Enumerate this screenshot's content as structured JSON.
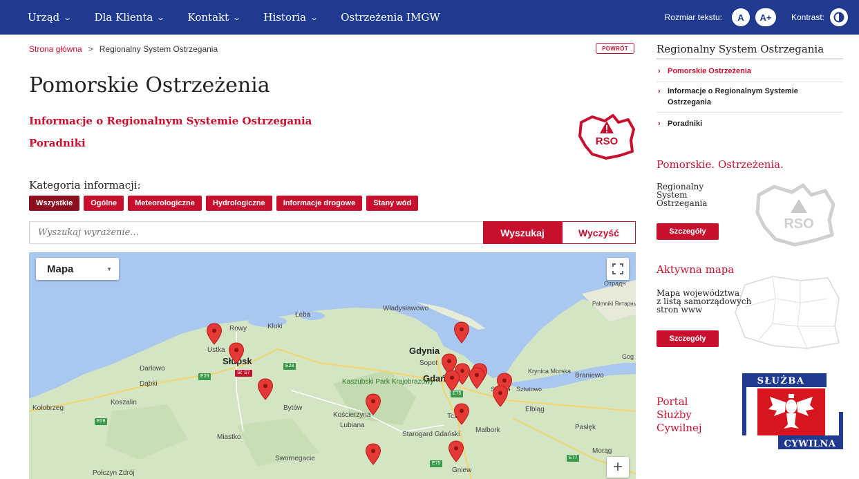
{
  "topnav": {
    "items": [
      {
        "label": "Urząd",
        "has_dropdown": true
      },
      {
        "label": "Dla Klienta",
        "has_dropdown": true
      },
      {
        "label": "Kontakt",
        "has_dropdown": true
      },
      {
        "label": "Historia",
        "has_dropdown": true
      },
      {
        "label": "Ostrzeżenia IMGW",
        "has_dropdown": false
      }
    ],
    "text_size_label": "Rozmiar tekstu:",
    "text_size_normal": "A",
    "text_size_large": "A+",
    "contrast_label": "Kontrast:",
    "bg_color": "#1f3a8f"
  },
  "breadcrumb": {
    "home": "Strona główna",
    "separator": ">",
    "current": "Regionalny System Ostrzegania"
  },
  "back_button": "POWRÓT",
  "page": {
    "title": "Pomorskie Ostrzeżenia",
    "link_info": "Informacje o Regionalnym Systemie Ostrzegania",
    "link_guides": "Poradniki",
    "logo_text": "RSO"
  },
  "filters": {
    "label": "Kategoria informacji:",
    "items": [
      "Wszystkie",
      "Ogólne",
      "Meteorologiczne",
      "Hydrologiczne",
      "Informacje drogowe",
      "Stany wód"
    ],
    "active": "Wszystkie"
  },
  "search": {
    "placeholder": "Wyszukaj wyrażenie...",
    "value": "",
    "search_label": "Wyszukaj",
    "clear_label": "Wyczyść"
  },
  "map": {
    "type_selected": "Mapa",
    "zoom_in": "+",
    "places": [
      {
        "name": "Władysławowo"
      },
      {
        "name": "Łeba"
      },
      {
        "name": "Rowy"
      },
      {
        "name": "Kluki"
      },
      {
        "name": "Ustka"
      },
      {
        "name": "Słupsk"
      },
      {
        "name": "Darłowo"
      },
      {
        "name": "Dąbki"
      },
      {
        "name": "Koszalin"
      },
      {
        "name": "Kołobrzeg"
      },
      {
        "name": "Bytów"
      },
      {
        "name": "Kościerzyna"
      },
      {
        "name": "Lubiana"
      },
      {
        "name": "Miastko"
      },
      {
        "name": "Gdynia"
      },
      {
        "name": "Sopot"
      },
      {
        "name": "Gdańsk"
      },
      {
        "name": "Kaszubski Park Krajobrazowy"
      },
      {
        "name": "Starogard Gdański"
      },
      {
        "name": "Tczew"
      },
      {
        "name": "Malbork"
      },
      {
        "name": "Elbląg"
      },
      {
        "name": "Pasłęk"
      },
      {
        "name": "Braniewo"
      },
      {
        "name": "Krynica Morska"
      },
      {
        "name": "Sztutowo"
      },
      {
        "name": "Stegna"
      },
      {
        "name": "Gniew"
      },
      {
        "name": "Swornegacie"
      },
      {
        "name": "Połczyn Zdrój"
      },
      {
        "name": "Palmniki Янтарный"
      },
      {
        "name": "Отрадн"
      },
      {
        "name": "Gog Гор"
      },
      {
        "name": "Morąg"
      }
    ],
    "roads": [
      "E28",
      "S6",
      "E28",
      "E28",
      "E75",
      "E77",
      "E75",
      "S7"
    ],
    "pin_color": "#e53935"
  },
  "sidebar": {
    "title": "Regionalny System Ostrzegania",
    "items": [
      {
        "label": "Pomorskie Ostrzeżenia",
        "active": true
      },
      {
        "label": "Informacje o Regionalnym Systemie Ostrzegania",
        "active": false
      },
      {
        "label": "Poradniki",
        "active": false
      }
    ],
    "box1_heading": "Pomorskie. Ostrzeżenia.",
    "box1_text": [
      "Regionalny",
      "System",
      "Ostrzegania"
    ],
    "box1_logo": "RSO",
    "box1_button": "Szczegóły",
    "box2_heading": "Aktywna mapa",
    "box2_text": [
      "Mapa województwa",
      "z listą samorządowych",
      "stron www"
    ],
    "box2_button": "Szczegóły",
    "portal_lines": [
      "Portal",
      "Służby",
      "Cywilnej"
    ],
    "sc_logo_top": "SŁUŻBA",
    "sc_logo_bottom": "CYWILNA"
  },
  "colors": {
    "accent": "#c8102e",
    "nav": "#1f3a8f",
    "active_filter": "#8b0f1e"
  }
}
